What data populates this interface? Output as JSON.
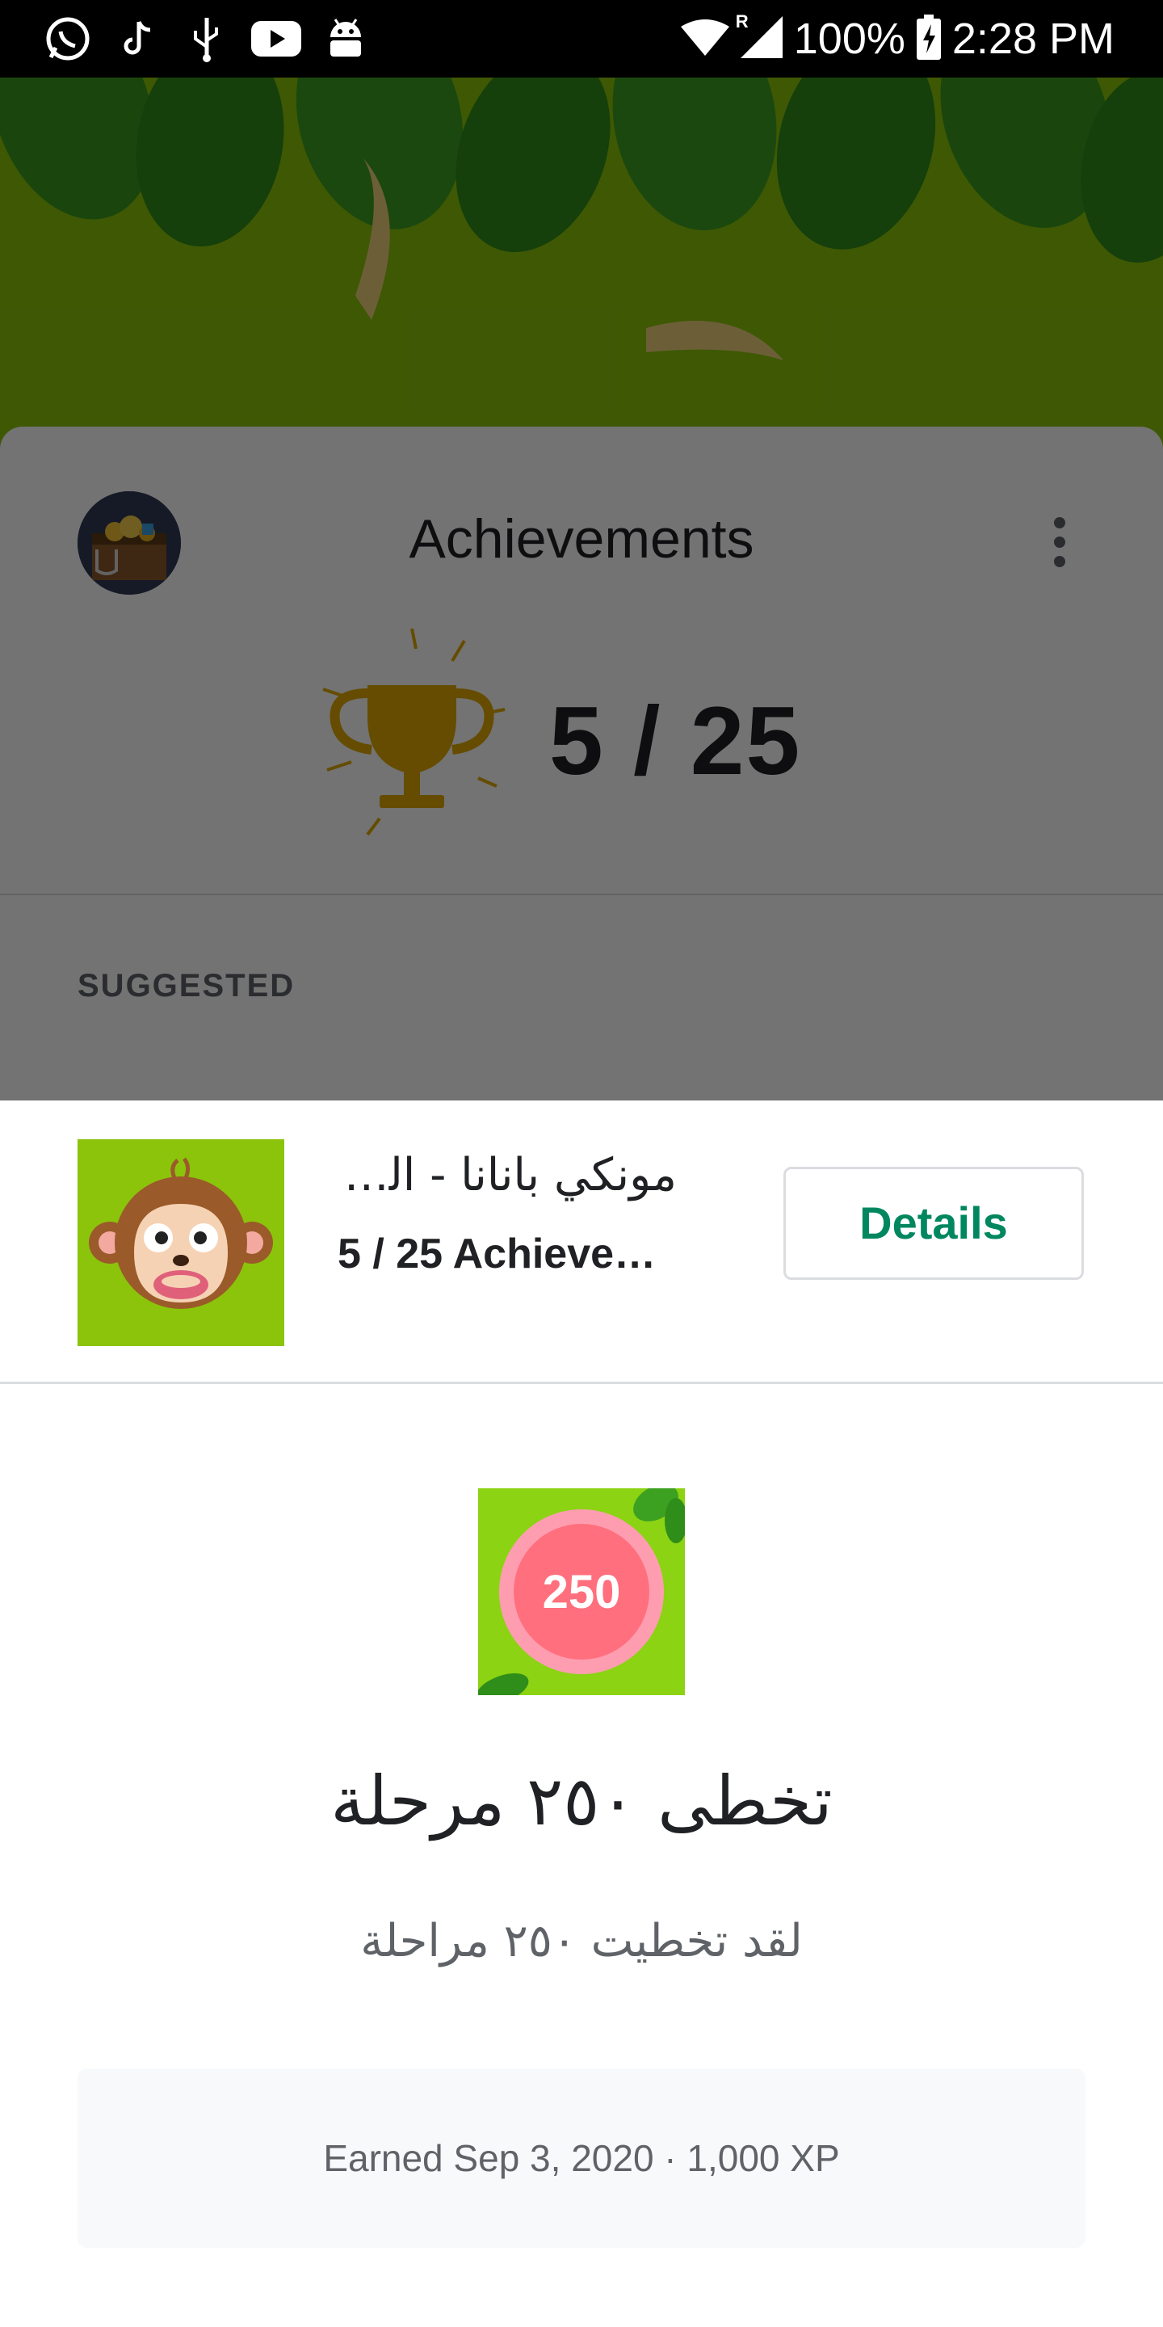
{
  "status_bar": {
    "left_icons": [
      "whatsapp-icon",
      "tiktok-icon",
      "usb-icon",
      "youtube-icon",
      "android-debug-icon"
    ],
    "network_indicator": "R",
    "battery": "100%",
    "time": "2:28 PM"
  },
  "sheet": {
    "title": "Achievements",
    "score": "5 / 25",
    "section_label": "SUGGESTED"
  },
  "game": {
    "title": "مونكي بانانا - الغ…",
    "subtitle": "5 / 25 Achieve…",
    "details_label": "Details"
  },
  "achievement": {
    "badge_number": "250",
    "title": "تخطى ٢٥٠ مرحلة",
    "description": "لقد تخطيت ٢٥٠ مراحلة",
    "earned": "Earned Sep 3, 2020 · 1,000 XP"
  },
  "colors": {
    "accent_green": "#01875f",
    "banner_green": "#8bc40b",
    "trophy_gold": "#e0a800",
    "badge_pink": "#ff6f7d"
  }
}
